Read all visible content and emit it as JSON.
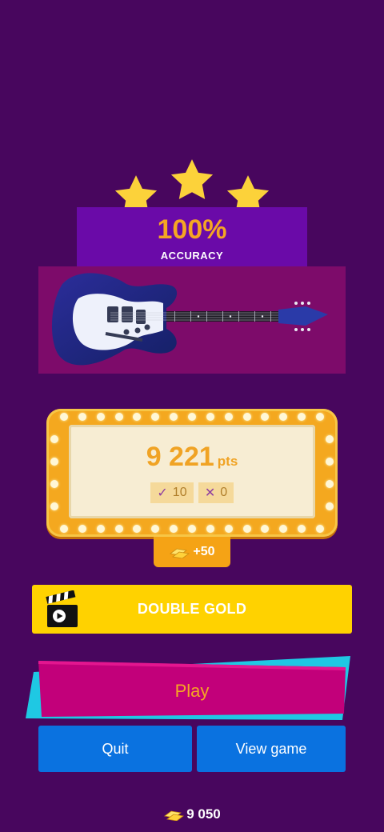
{
  "result": {
    "stars": 3,
    "accuracy_value": "100%",
    "accuracy_label": "ACCURACY",
    "subject_icon": "electric-guitar-icon"
  },
  "score": {
    "points": "9 221",
    "unit": "pts",
    "correct_count": "10",
    "wrong_count": "0"
  },
  "reward": {
    "gold_bonus": "+50"
  },
  "actions": {
    "double_gold_label": "DOUBLE GOLD",
    "play_label": "Play",
    "quit_label": "Quit",
    "view_game_label": "View game"
  },
  "footer": {
    "gold_balance": "9 050"
  },
  "colors": {
    "background": "#48065e",
    "accent_gold": "#f5a623",
    "play_button": "#c2007a",
    "blue_button": "#0a72e0",
    "double_gold_button": "#ffd200"
  }
}
